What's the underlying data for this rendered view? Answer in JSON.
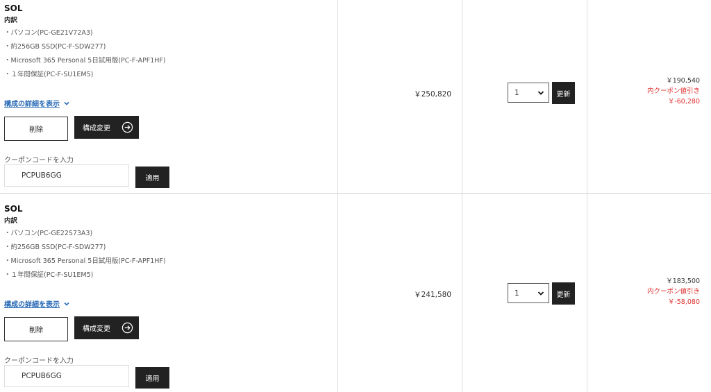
{
  "rows": [
    {
      "name": "SOL",
      "breakdown_label": "内訳",
      "items": [
        "・パソコン(PC-GE21V72A3)",
        "・約256GB SSD(PC-F-SDW277)",
        "・Microsoft 365 Personal 5日試用版(PC-F-APF1HF)",
        "・１年間保証(PC-F-SU1EM5)"
      ],
      "details_link": "構成の詳細を表示",
      "delete_label": "削除",
      "config_label": "構成変更",
      "coupon_label": "クーポンコードを入力",
      "coupon_value": "PCPUB6GG",
      "apply_label": "適用",
      "unit_price": "￥250,820",
      "quantity": "1",
      "update_label": "更新",
      "total": "￥190,540",
      "coupon_discount_label": "内クーポン値引き",
      "coupon_discount": "￥-60,280"
    },
    {
      "name": "SOL",
      "breakdown_label": "内訳",
      "items": [
        "・パソコン(PC-GE22S73A3)",
        "・約256GB SSD(PC-F-SDW277)",
        "・Microsoft 365 Personal 5日試用版(PC-F-APF1HF)",
        "・１年間保証(PC-F-SU1EM5)"
      ],
      "details_link": "構成の詳細を表示",
      "delete_label": "削除",
      "config_label": "構成変更",
      "coupon_label": "クーポンコードを入力",
      "coupon_value": "PCPUB6GG",
      "apply_label": "適用",
      "unit_price": "￥241,580",
      "quantity": "1",
      "update_label": "更新",
      "total": "￥183,500",
      "coupon_discount_label": "内クーポン値引き",
      "coupon_discount": "￥-58,080"
    }
  ],
  "icons": {
    "details_toggle": "chevron-down-icon",
    "config_arrow": "arrow-right-circle-icon",
    "qty_dropdown": "chevron-down-icon"
  },
  "colors": {
    "link": "#2a6bb7",
    "discount": "#e03030",
    "button_dark": "#222222"
  }
}
